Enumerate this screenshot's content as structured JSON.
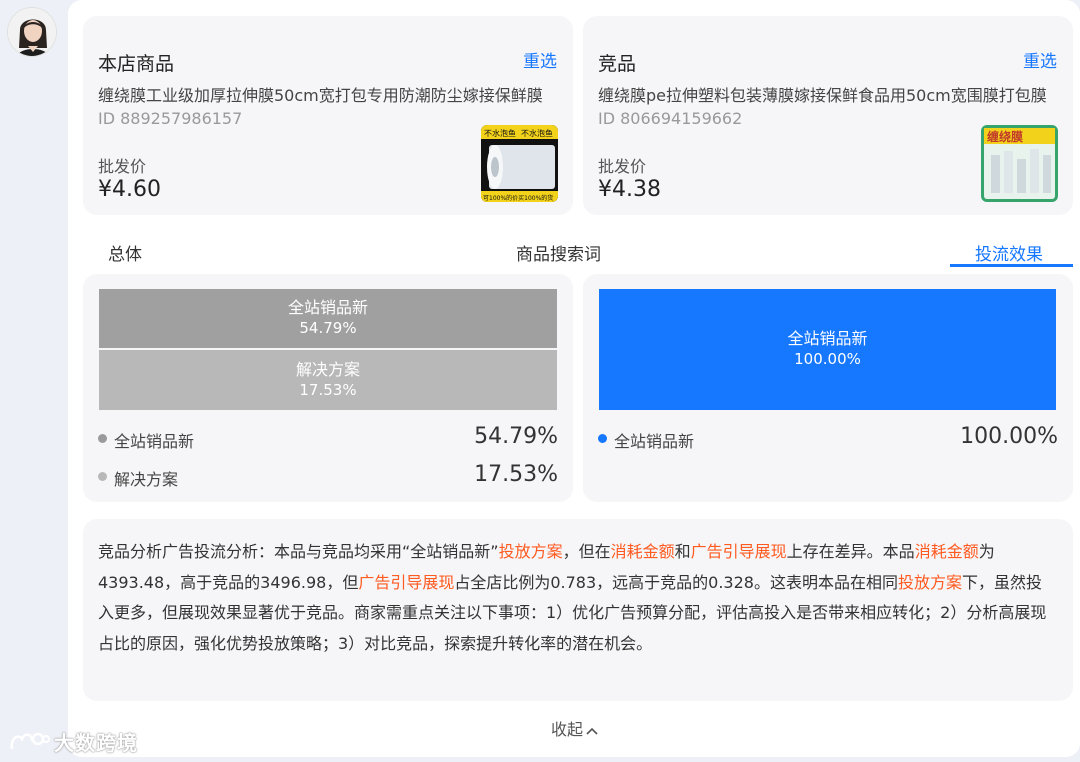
{
  "mine": {
    "title": "本店商品",
    "reselect": "重选",
    "name": "缠绕膜工业级加厚拉伸膜50cm宽打包专用防潮防尘嫁接保鲜膜",
    "id": "ID 889257986157",
    "price_label": "批发价",
    "price": "¥4.60",
    "thumb_text": [
      "不水泡鱼",
      "不水泡鱼",
      "可100%的价买100%的货"
    ]
  },
  "rival": {
    "title": "竞品",
    "reselect": "重选",
    "name": "缠绕膜pe拉伸塑料包装薄膜嫁接保鲜食品用50cm宽围膜打包膜",
    "id": "ID 806694159662",
    "price_label": "批发价",
    "price": "¥4.38",
    "thumb_text": "缠绕膜"
  },
  "tabs": [
    "总体",
    "商品搜索词",
    "投流效果"
  ],
  "active_tab": 2,
  "mine_stats": {
    "items": [
      {
        "name": "全站销品新",
        "pct": "54.79%",
        "color": "#a0a0a0"
      },
      {
        "name": "解决方案",
        "pct": "17.53%",
        "color": "#b8b8b8"
      }
    ]
  },
  "rival_stats": {
    "items": [
      {
        "name": "全站销品新",
        "pct": "100.00%",
        "color": "#1677ff"
      }
    ]
  },
  "analysis": {
    "p1": "竞品分析广告投流分析：本品与竞品均采用“全站销品新”",
    "h1": "投放方案",
    "p2": "，但在",
    "h2": "消耗金额",
    "p3": "和",
    "h3": "广告引导展现",
    "p4": "上存在差异。本品",
    "h4": "消耗金额",
    "p5": "为4393.48，高于竞品的3496.98，但",
    "h5": "广告引导展现",
    "p6": "占全店比例为0.783，远高于竞品的0.328。这表明本品在相同",
    "h6": "投放方案",
    "p7": "下，虽然投入更多，但展现效果显著优于竞品。商家需重点关注以下事项：1）优化广告预算分配，评估高投入是否带来相应转化；2）分析高展现占比的原因，强化优势投放策略；3）对比竞品，探索提升转化率的潜在机会。"
  },
  "collapse_label": "收起",
  "watermark": "大数跨境",
  "colors": {
    "accent": "#1677ff",
    "highlight": "#ff5a1f"
  }
}
